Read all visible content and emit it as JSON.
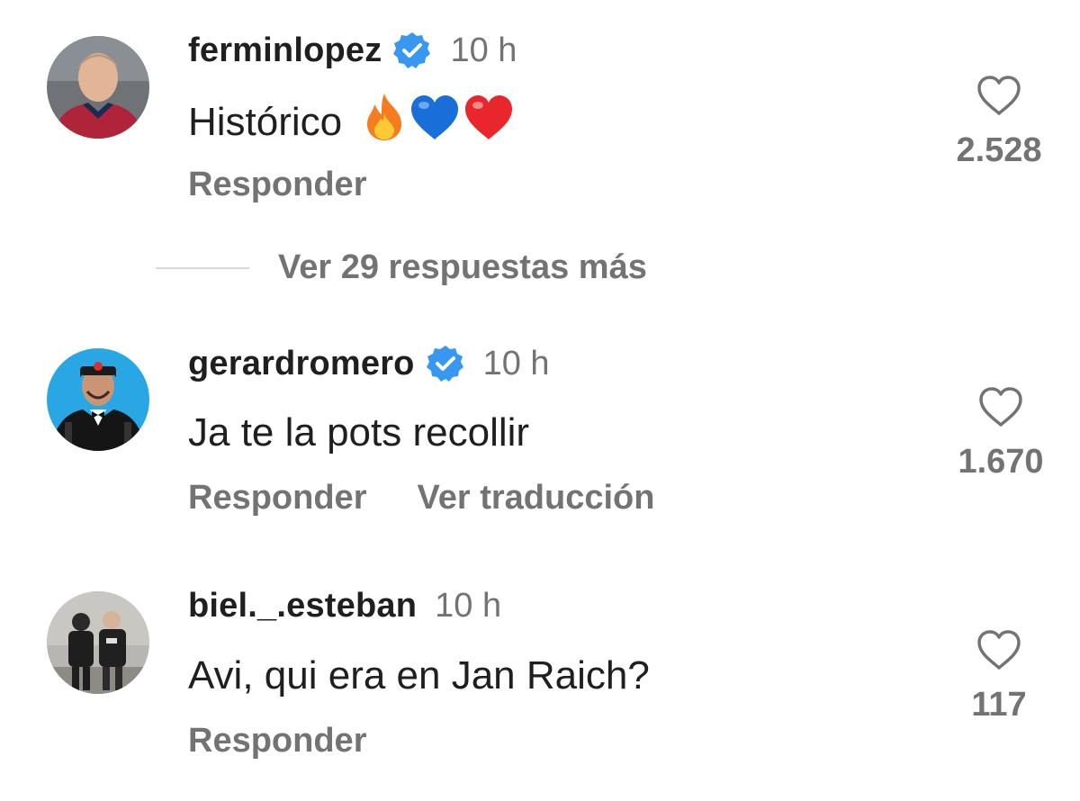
{
  "comments": [
    {
      "username": "ferminlopez",
      "verified": true,
      "time": "10 h",
      "text": "Histórico",
      "emojis": [
        "fire-emoji",
        "blue-heart-emoji",
        "red-heart-emoji"
      ],
      "actions": [
        "Responder"
      ],
      "likes": "2.528"
    },
    {
      "username": "gerardromero",
      "verified": true,
      "time": "10 h",
      "text": "Ja te la pots recollir",
      "actions": [
        "Responder",
        "Ver traducción"
      ],
      "likes": "1.670"
    },
    {
      "username": "biel._.esteban",
      "verified": false,
      "time": "10 h",
      "text": "Avi, qui era en Jan Raich?",
      "actions": [
        "Responder"
      ],
      "likes": "117"
    }
  ],
  "replies": {
    "label": "Ver 29 respuestas más"
  },
  "colors": {
    "text": "#1f1f1f",
    "secondary": "#737373",
    "verified": "#3897f0",
    "divider": "#d9d9d9"
  }
}
